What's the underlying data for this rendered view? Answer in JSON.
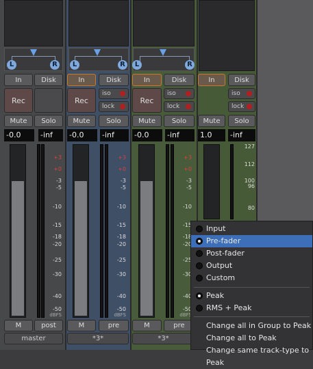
{
  "strips": [
    {
      "pan_l": "L",
      "pan_r": "R",
      "in": "In",
      "disk": "Disk",
      "rec": "Rec",
      "mute": "Mute",
      "solo": "Solo",
      "gain": "-0.0",
      "peak": "-inf",
      "m": "M",
      "meterpoint": "post",
      "name": "master"
    },
    {
      "pan_l": "L",
      "pan_r": "R",
      "in": "In",
      "disk": "Disk",
      "iso": "iso",
      "lock": "lock",
      "rec": "Rec",
      "mute": "Mute",
      "solo": "Solo",
      "gain": "-0.0",
      "peak": "-inf",
      "m": "M",
      "meterpoint": "pre",
      "name": "*3*"
    },
    {
      "pan_l": "L",
      "pan_r": "R",
      "in": "In",
      "disk": "Disk",
      "iso": "iso",
      "lock": "lock",
      "rec": "Rec",
      "mute": "Mute",
      "solo": "Solo",
      "gain": "-0.0",
      "peak": "-inf",
      "m": "M",
      "meterpoint": "pre",
      "name": "*3*"
    },
    {
      "in": "In",
      "disk": "Disk",
      "iso": "iso",
      "lock": "lock",
      "mute": "Mute",
      "solo": "Solo",
      "gain": "1.0",
      "peak": "-inf"
    }
  ],
  "scale": {
    "ticks": [
      "+3",
      "+0",
      "-3",
      "-5",
      "-10",
      "-15",
      "-18",
      "-20",
      "-25",
      "-30",
      "-40",
      "-50"
    ],
    "dbfs": "dBFS"
  },
  "midi_scale": [
    "127",
    "112",
    "100",
    "96",
    "80"
  ],
  "fader_level": 0.78,
  "context_menu": {
    "meterpoint_options": [
      {
        "label": "Input",
        "selected": false
      },
      {
        "label": "Pre-fader",
        "selected": true
      },
      {
        "label": "Post-fader",
        "selected": false
      },
      {
        "label": "Output",
        "selected": false
      },
      {
        "label": "Custom",
        "selected": false
      }
    ],
    "metertype_options": [
      {
        "label": "Peak",
        "selected": true
      },
      {
        "label": "RMS + Peak",
        "selected": false
      }
    ],
    "actions": [
      "Change all in Group to Peak",
      "Change all to Peak",
      "Change same track-type to Peak"
    ]
  }
}
